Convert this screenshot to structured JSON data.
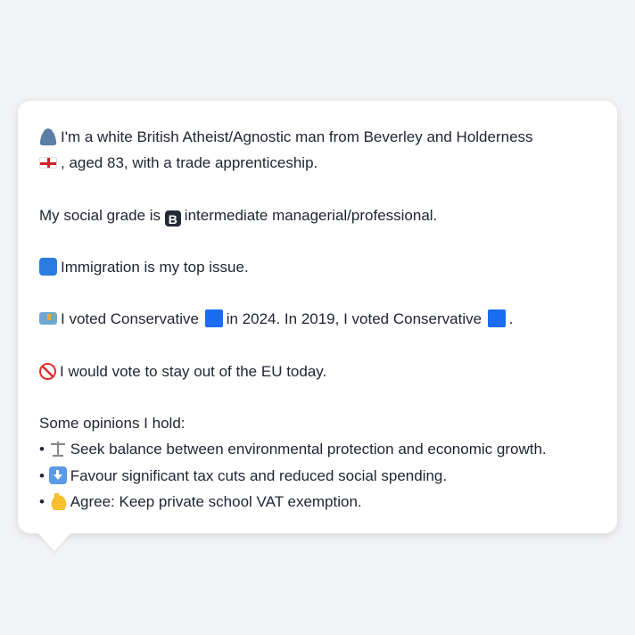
{
  "profile": {
    "line1": "I'm a white British Atheist/Agnostic man from Beverley and Holderness",
    "line2": ", aged 83, with a trade apprenticeship.",
    "grade_prefix": "My social grade is",
    "grade_text": "intermediate managerial/professional.",
    "grade_letter": "B",
    "issue": "Immigration is my top issue.",
    "vote_a": "I voted Conservative",
    "vote_b": "in 2024. In 2019, I voted Conservative",
    "vote_c": ".",
    "eu": "I would vote to stay out of the EU today.",
    "opinions_heading": "Some opinions I hold:",
    "bullet": "•",
    "opinions": [
      {
        "icon": "balance-scale-icon",
        "text": "Seek balance between environmental protection and economic growth."
      },
      {
        "icon": "down-arrow-icon",
        "text": "Favour significant tax cuts and reduced social spending."
      },
      {
        "icon": "thumbs-up-icon",
        "text": "Agree: Keep private school VAT exemption."
      }
    ]
  },
  "colors": {
    "conservative": "#1a6cf0",
    "background": "#f2f3f5"
  }
}
